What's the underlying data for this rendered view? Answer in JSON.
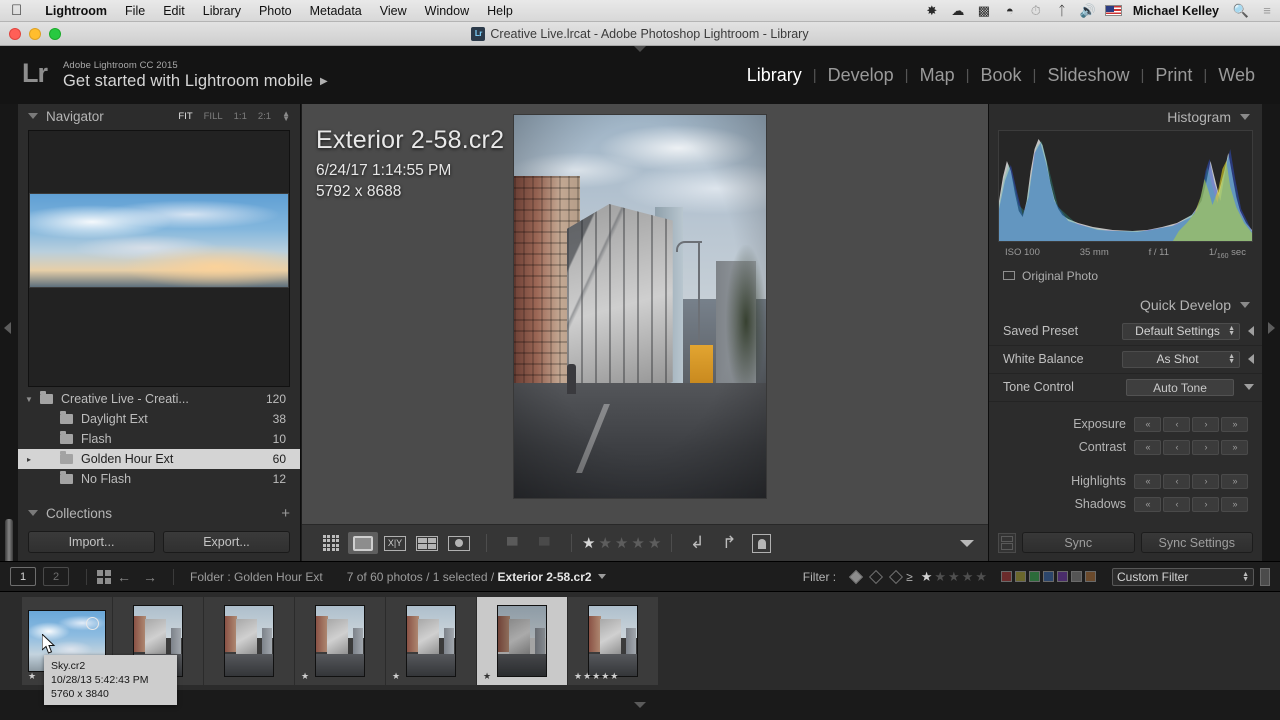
{
  "menubar": {
    "apple_icon": "apple-icon",
    "items": [
      "Lightroom",
      "File",
      "Edit",
      "Library",
      "Photo",
      "Metadata",
      "View",
      "Window",
      "Help"
    ],
    "status_icons": [
      "dropbox-icon",
      "creative-cloud-icon",
      "airplay-icon",
      "wifi-icon",
      "timemachine-icon",
      "bluetooth-icon",
      "volume-icon",
      "us-flag-icon"
    ],
    "user": "Michael Kelley",
    "search_icon": "search-icon",
    "notification_icon": "notification-center-icon"
  },
  "window": {
    "title": "Creative Live.lrcat - Adobe Photoshop Lightroom - Library",
    "app_badge": "Lr"
  },
  "identity": {
    "logo": "Lr",
    "product": "Adobe Lightroom CC 2015",
    "headline": "Get started with Lightroom mobile",
    "arrow": "▶"
  },
  "modules": {
    "items": [
      "Library",
      "Develop",
      "Map",
      "Book",
      "Slideshow",
      "Print",
      "Web"
    ],
    "active": "Library"
  },
  "navigator": {
    "title": "Navigator",
    "zoom_levels": [
      "FIT",
      "FILL",
      "1:1",
      "2:1"
    ],
    "active_zoom": "FIT"
  },
  "folders": [
    {
      "name": "Creative Live - Creati...",
      "count": "120",
      "level": 0,
      "expanded": true,
      "selected": false
    },
    {
      "name": "Daylight Ext",
      "count": "38",
      "level": 1,
      "expanded": false,
      "selected": false
    },
    {
      "name": "Flash",
      "count": "10",
      "level": 1,
      "expanded": false,
      "selected": false
    },
    {
      "name": "Golden Hour Ext",
      "count": "60",
      "level": 1,
      "expanded": false,
      "selected": true
    },
    {
      "name": "No Flash",
      "count": "12",
      "level": 1,
      "expanded": false,
      "selected": false
    }
  ],
  "collections": {
    "title": "Collections",
    "add_icon": "plus-icon"
  },
  "left_buttons": {
    "import": "Import...",
    "export": "Export..."
  },
  "loupe": {
    "filename": "Exterior 2-58.cr2",
    "capture_time": "6/24/17 1:14:55 PM",
    "dimensions": "5792 x 8688"
  },
  "toolbar": {
    "view_modes": [
      "grid-view-icon",
      "loupe-view-icon",
      "compare-view-icon",
      "survey-view-icon",
      "people-view-icon"
    ],
    "active_view": "loupe-view-icon",
    "flag_icon": "flag-icon",
    "reject_icon": "reject-flag-icon",
    "rating_stars": 1,
    "rotate_left_icon": "rotate-left-icon",
    "rotate_right_icon": "rotate-right-icon",
    "crop_icon": "crop-overlay-icon",
    "toolbar_caret": "chevron-down-icon"
  },
  "histogram": {
    "title": "Histogram",
    "iso": "ISO 100",
    "focal_length": "35 mm",
    "aperture": "f / 11",
    "shutter_prefix": "1/",
    "shutter_value": "160",
    "shutter_suffix": "sec",
    "original_photo": "Original Photo"
  },
  "quick_develop": {
    "title": "Quick Develop",
    "rows": [
      {
        "label": "Saved Preset",
        "value": "Default Settings"
      },
      {
        "label": "White Balance",
        "value": "As Shot"
      }
    ],
    "tone_control_label": "Tone Control",
    "auto_tone": "Auto Tone",
    "adjustments": [
      "Exposure",
      "Contrast",
      "Highlights",
      "Shadows"
    ],
    "step_labels": [
      "«",
      "‹",
      "›",
      "»"
    ]
  },
  "sync": {
    "sync": "Sync",
    "sync_settings": "Sync Settings"
  },
  "filmstrip_bar": {
    "screen1": "1",
    "screen2": "2",
    "grid_icon": "grid-icon",
    "back_icon": "arrow-left-icon",
    "forward_icon": "arrow-right-icon",
    "source": "Folder : Golden Hour Ext",
    "count_text": "7 of 60 photos / 1 selected / ",
    "selected_file": "Exterior 2-58.cr2",
    "filter_label": "Filter :",
    "filter_stars_active": 1,
    "custom_filter": "Custom Filter",
    "color_swatches": [
      "#6b2c2c",
      "#6b672c",
      "#2c6b3a",
      "#2c466b",
      "#4a2c6b",
      "#555555",
      "#6b4a2c"
    ]
  },
  "filmstrip_thumbs": [
    {
      "type": "sky",
      "rating": "★",
      "selected": false,
      "badge": "cr2",
      "circle": true
    },
    {
      "type": "street",
      "rating": "",
      "selected": false
    },
    {
      "type": "street",
      "rating": "",
      "selected": false
    },
    {
      "type": "street",
      "rating": "★",
      "selected": false
    },
    {
      "type": "street",
      "rating": "★",
      "selected": false
    },
    {
      "type": "street",
      "rating": "★",
      "selected": true
    },
    {
      "type": "street",
      "rating": "★★★★★",
      "selected": false
    }
  ],
  "tooltip": {
    "filename": "Sky.cr2",
    "capture_time": "10/28/13 5:42:43 PM",
    "dimensions": "5760 x 3840"
  }
}
